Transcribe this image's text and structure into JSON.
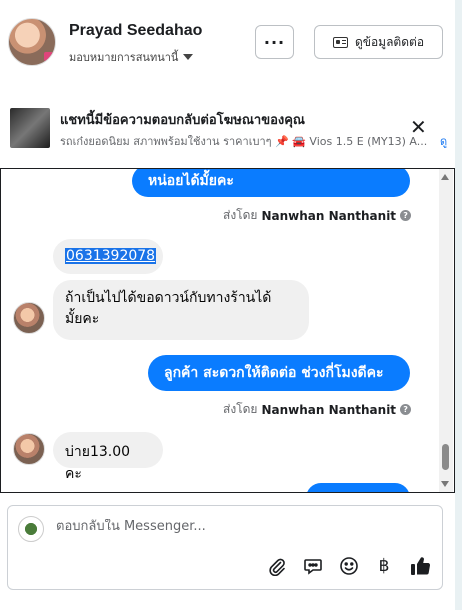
{
  "header": {
    "name": "Prayad Seedahao",
    "assign_label": "มอบหมายการสนทนานี้",
    "more_label": "···",
    "contact_button_label": "ดูข้อมูลติดต่อ"
  },
  "ad": {
    "title": "แชทนี้มีข้อความตอบกลับต่อโฆษณาของคุณ",
    "subtitle": "รถเก๋งยอดนิยม สภาพพร้อมใช้งาน ราคาเบาๆ 📌 🚘 Vios 1.5 E (MY13) A...",
    "subtitle_tail": "ดู"
  },
  "messages": [
    {
      "direction": "out",
      "text": "หน่อยได้มั้ยคะ"
    },
    {
      "sent_by_prefix": "ส่งโดย",
      "sent_by_name": "Nanwhan Nanthanit"
    },
    {
      "direction": "in",
      "text": "0631392078"
    },
    {
      "direction": "in",
      "text_line1": "ถ้าเป็นไปได้ขอดาวน์กับทางร้านได้",
      "text_line2": "มั้ยคะ"
    },
    {
      "direction": "out",
      "text": "ลูกค้า  สะดวกให้ติดต่อ ช่วงกี่โมงดีคะ"
    },
    {
      "sent_by_prefix": "ส่งโดย",
      "sent_by_name": "Nanwhan Nanthanit"
    },
    {
      "direction": "in",
      "text": "บ่าย13.00 คะ"
    }
  ],
  "composer": {
    "placeholder": "ตอบกลับใน Messenger...",
    "tools": [
      "paperclip-icon",
      "speech-bubble-icon",
      "smiley-icon",
      "baht-icon",
      "thumbs-up-icon"
    ],
    "baht_symbol": "฿"
  },
  "colors": {
    "accent": "#0a7cff",
    "incoming_bubble": "#f0f0f0"
  }
}
